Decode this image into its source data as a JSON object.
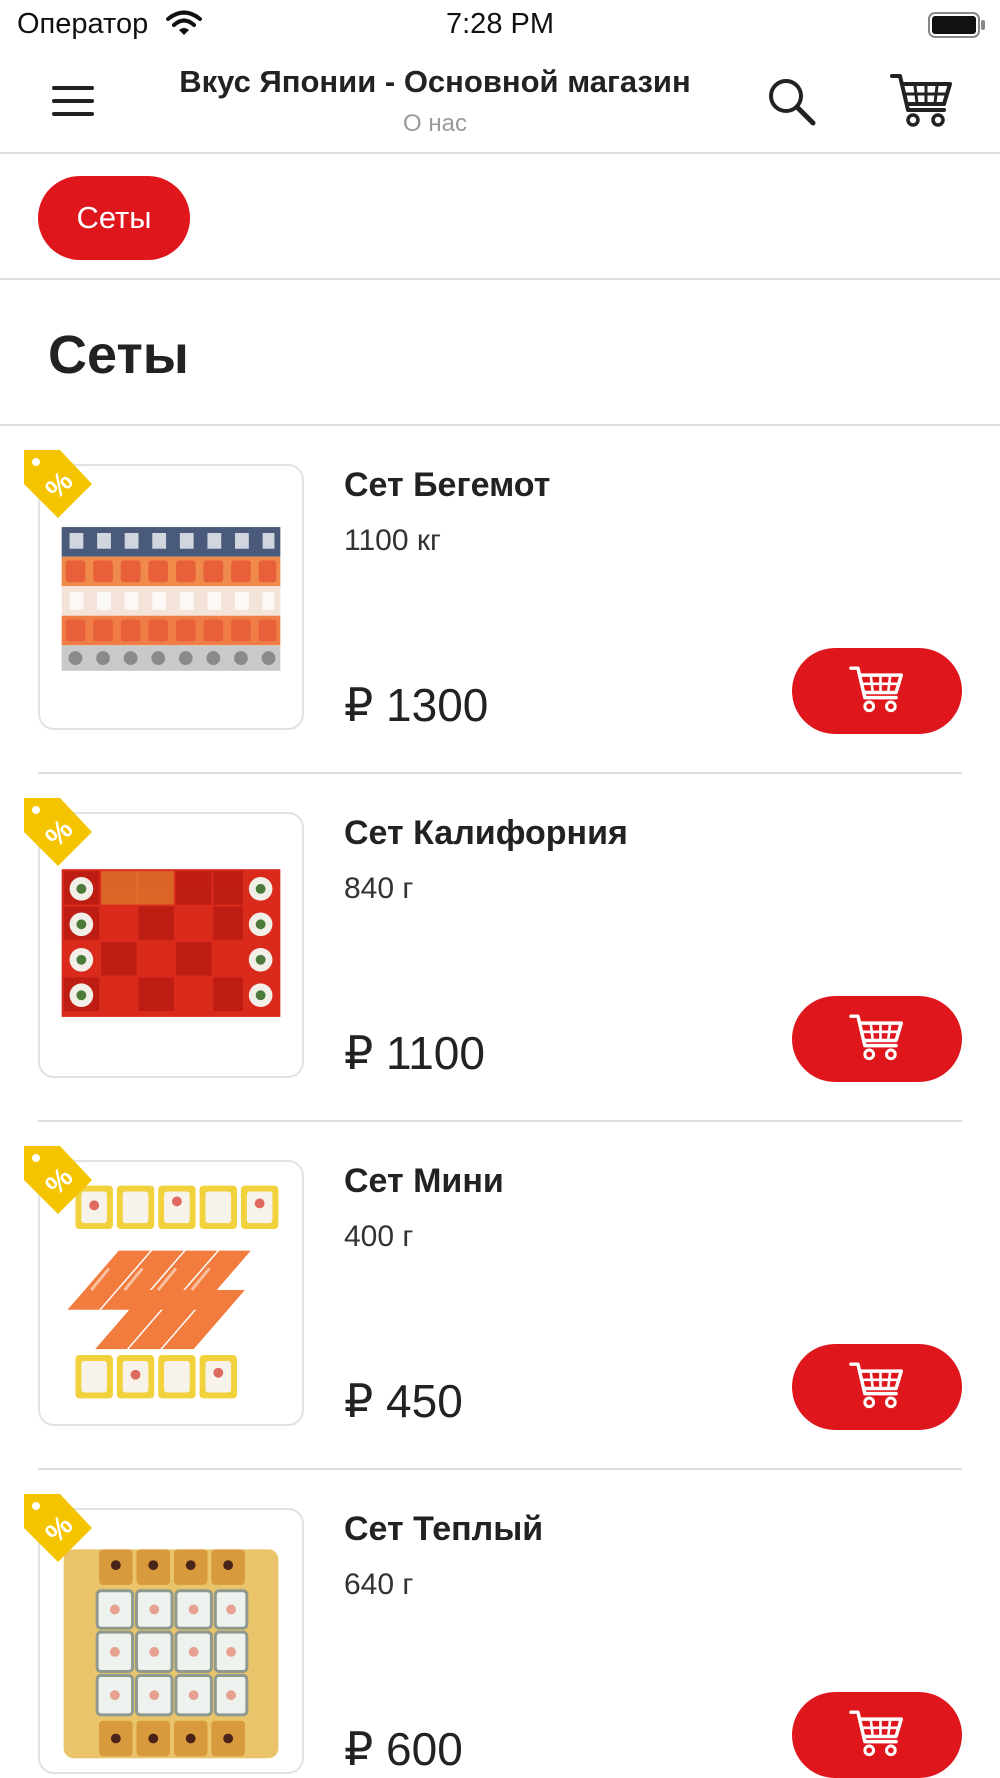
{
  "status_bar": {
    "carrier": "Оператор",
    "time": "7:28 PM"
  },
  "nav": {
    "title": "Вкус Японии - Основной магазин",
    "subtitle": "О нас",
    "icons": [
      "menu-icon",
      "search-icon",
      "cart-icon"
    ]
  },
  "categories": {
    "chips": [
      {
        "label": "Сеты",
        "active": true
      }
    ]
  },
  "section": {
    "title": "Сеты"
  },
  "colors": {
    "accent": "#e0161d",
    "discount_tag": "#f5c400",
    "divider": "#dcdcdc"
  },
  "products": [
    {
      "name": "Сет Бегемот",
      "weight": "1100 кг",
      "price": "₽ 1300",
      "has_discount": true
    },
    {
      "name": "Сет Калифорния",
      "weight": "840 г",
      "price": "₽ 1100",
      "has_discount": true
    },
    {
      "name": "Сет Мини",
      "weight": "400 г",
      "price": "₽ 450",
      "has_discount": true
    },
    {
      "name": "Сет Теплый",
      "weight": "640 г",
      "price": "₽ 600",
      "has_discount": true
    }
  ]
}
